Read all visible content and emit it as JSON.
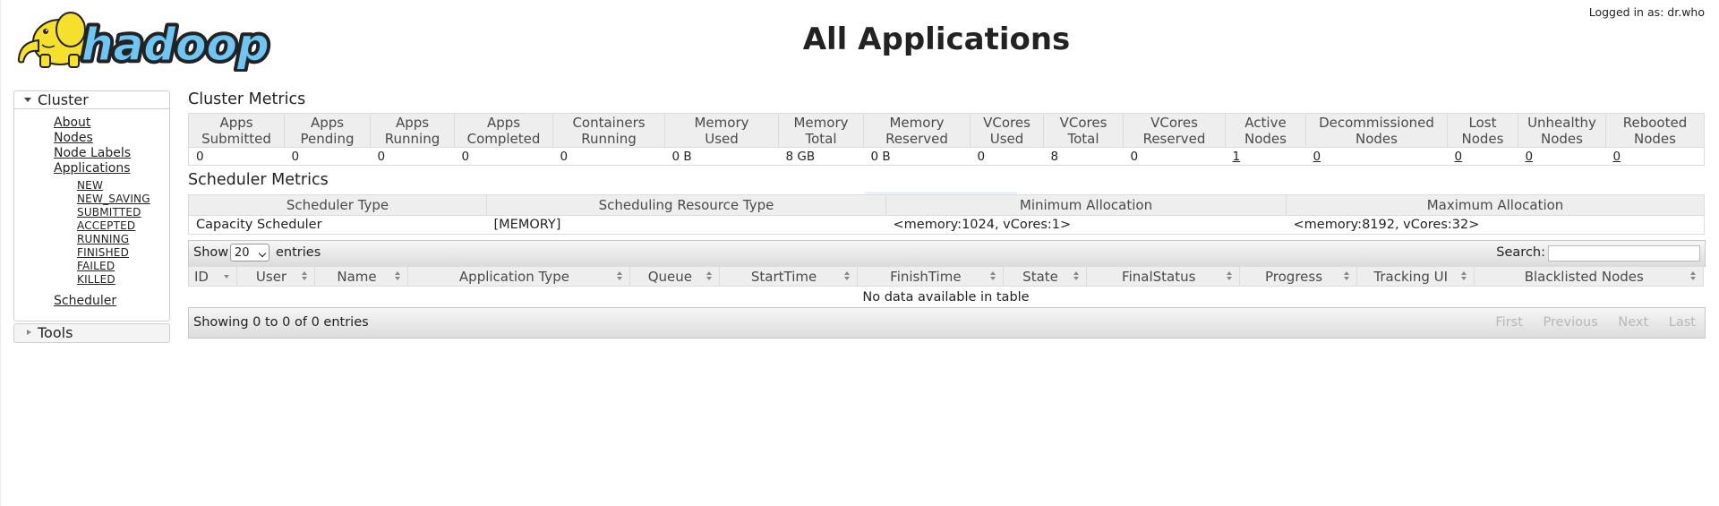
{
  "header": {
    "logo_text": "hadoop",
    "title": "All Applications",
    "logged_in": "Logged in as: dr.who"
  },
  "nav": {
    "cluster": {
      "label": "Cluster",
      "links": [
        "About",
        "Nodes",
        "Node Labels",
        "Applications"
      ],
      "app_states": [
        "NEW",
        "NEW_SAVING",
        "SUBMITTED",
        "ACCEPTED",
        "RUNNING",
        "FINISHED",
        "FAILED",
        "KILLED"
      ],
      "scheduler": "Scheduler"
    },
    "tools": {
      "label": "Tools"
    }
  },
  "cluster_metrics": {
    "heading": "Cluster Metrics",
    "columns": [
      {
        "l1": "Apps",
        "l2": "Submitted"
      },
      {
        "l1": "Apps",
        "l2": "Pending"
      },
      {
        "l1": "Apps",
        "l2": "Running"
      },
      {
        "l1": "Apps",
        "l2": "Completed"
      },
      {
        "l1": "Containers",
        "l2": "Running"
      },
      {
        "l1": "Memory",
        "l2": "Used"
      },
      {
        "l1": "Memory",
        "l2": "Total"
      },
      {
        "l1": "Memory",
        "l2": "Reserved"
      },
      {
        "l1": "VCores",
        "l2": "Used"
      },
      {
        "l1": "VCores",
        "l2": "Total"
      },
      {
        "l1": "VCores",
        "l2": "Reserved"
      },
      {
        "l1": "Active",
        "l2": "Nodes"
      },
      {
        "l1": "Decommissioned",
        "l2": "Nodes"
      },
      {
        "l1": "Lost",
        "l2": "Nodes"
      },
      {
        "l1": "Unhealthy",
        "l2": "Nodes"
      },
      {
        "l1": "Rebooted",
        "l2": "Nodes"
      }
    ],
    "values": [
      "0",
      "0",
      "0",
      "0",
      "0",
      "0 B",
      "8 GB",
      "0 B",
      "0",
      "8",
      "0",
      "1",
      "0",
      "0",
      "0",
      "0"
    ]
  },
  "scheduler_metrics": {
    "heading": "Scheduler Metrics",
    "columns": [
      "Scheduler Type",
      "Scheduling Resource Type",
      "Minimum Allocation",
      "Maximum Allocation"
    ],
    "values": [
      "Capacity Scheduler",
      "[MEMORY]",
      "<memory:1024, vCores:1>",
      "<memory:8192, vCores:32>"
    ]
  },
  "apps_table": {
    "show_label": "Show",
    "page_length": "20",
    "entries_label": "entries",
    "search_label": "Search:",
    "columns": [
      "ID",
      "User",
      "Name",
      "Application Type",
      "Queue",
      "StartTime",
      "FinishTime",
      "State",
      "FinalStatus",
      "Progress",
      "Tracking UI",
      "Blacklisted Nodes"
    ],
    "empty_message": "No data available in table",
    "info": "Showing 0 to 0 of 0 entries",
    "pager": [
      "First",
      "Previous",
      "Next",
      "Last"
    ]
  },
  "colors": {
    "header_bg": "#eeeeee",
    "border": "#dcdcdc",
    "logo_yellow": "#f5e12b",
    "logo_blue": "#6ec6f5"
  }
}
